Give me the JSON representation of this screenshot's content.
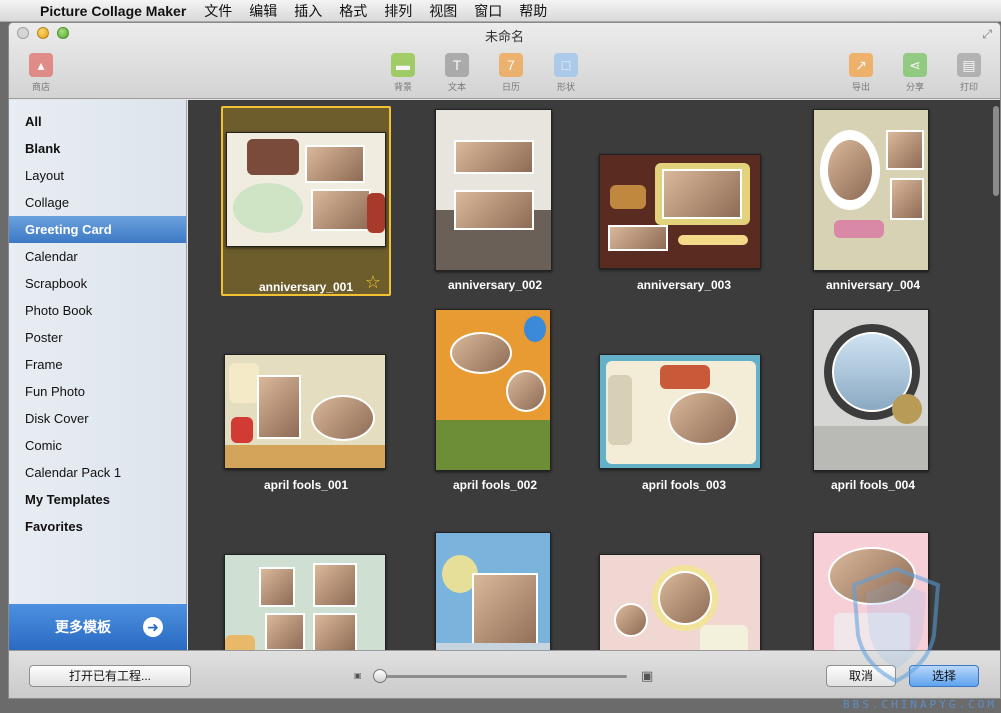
{
  "menubar": {
    "app_name": "Picture Collage Maker",
    "items": [
      "文件",
      "编辑",
      "插入",
      "格式",
      "排列",
      "视图",
      "窗口",
      "帮助"
    ]
  },
  "window": {
    "title": "未命名"
  },
  "toolbar": {
    "store": "商店",
    "background": "背景",
    "text": "文本",
    "calendar": "日历",
    "shape": "形状",
    "export": "导出",
    "share": "分享",
    "print": "打印"
  },
  "sidebar": {
    "items": [
      {
        "label": "All",
        "bold": true
      },
      {
        "label": "Blank",
        "bold": true
      },
      {
        "label": "Layout",
        "bold": false
      },
      {
        "label": "Collage",
        "bold": false
      },
      {
        "label": "Greeting Card",
        "bold": false,
        "selected": true
      },
      {
        "label": "Calendar",
        "bold": false
      },
      {
        "label": "Scrapbook",
        "bold": false
      },
      {
        "label": "Photo Book",
        "bold": false
      },
      {
        "label": "Poster",
        "bold": false
      },
      {
        "label": "Frame",
        "bold": false
      },
      {
        "label": "Fun Photo",
        "bold": false
      },
      {
        "label": "Disk Cover",
        "bold": false
      },
      {
        "label": "Comic",
        "bold": false
      },
      {
        "label": "Calendar Pack 1",
        "bold": false
      },
      {
        "label": "My Templates",
        "bold": true
      },
      {
        "label": "Favorites",
        "bold": true
      }
    ],
    "more_templates": "更多模板"
  },
  "templates": [
    {
      "name": "anniversary_001",
      "selected": true,
      "favorite": true
    },
    {
      "name": "anniversary_002"
    },
    {
      "name": "anniversary_003"
    },
    {
      "name": "anniversary_004"
    },
    {
      "name": "april fools_001"
    },
    {
      "name": "april fools_002"
    },
    {
      "name": "april fools_003"
    },
    {
      "name": "april fools_004"
    },
    {
      "name": ""
    },
    {
      "name": ""
    },
    {
      "name": ""
    },
    {
      "name": ""
    }
  ],
  "bottombar": {
    "open_existing": "打开已有工程...",
    "cancel": "取消",
    "choose": "选择"
  },
  "watermark": "BBS.CHINAPYG.COM"
}
